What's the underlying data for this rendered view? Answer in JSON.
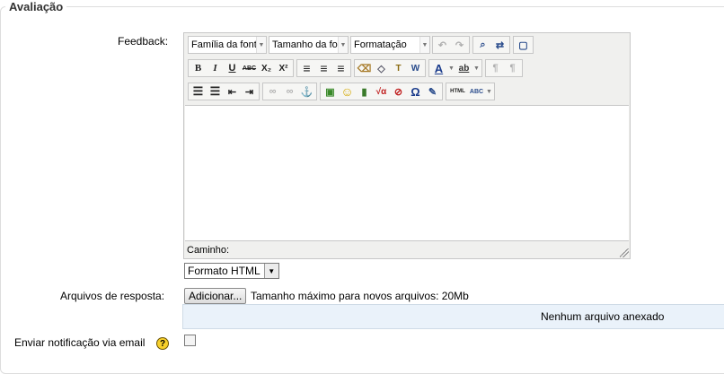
{
  "section": {
    "title": "Avaliação"
  },
  "feedback": {
    "label": "Feedback:",
    "font_family": "Família da font",
    "font_size": "Tamanho da fo",
    "format_block": "Formatação",
    "path_label": "Caminho:",
    "text_format": "Formato HTML",
    "icons": {
      "undo": "↶",
      "redo": "↷",
      "find": "⌕",
      "replace": "⇄",
      "fullscreen": "▢",
      "bold": "B",
      "italic": "I",
      "underline": "U",
      "strike": "ABC",
      "sub": "X₂",
      "sup": "X²",
      "align_left": "≡",
      "align_center": "≡",
      "align_right": "≡",
      "cleanup": "⌫",
      "erase": "◇",
      "paste_text": "T",
      "paste_word": "W",
      "forecolor": "A",
      "backcolor": "ab",
      "ltr": "¶",
      "rtl": "¶",
      "ul": "☰",
      "ol": "☰",
      "outdent": "⇤",
      "indent": "⇥",
      "link": "∞",
      "unlink": "∞",
      "anchor": "⚓",
      "image": "▣",
      "emoticon": "☺",
      "media": "▮",
      "equation": "√α",
      "nolink": "⊘",
      "charmap": "Ω",
      "edit": "✎",
      "html": "HTML",
      "spell": "ABC"
    }
  },
  "attachments": {
    "label": "Arquivos de resposta:",
    "add_button": "Adicionar...",
    "max_size": "Tamanho máximo para novos arquivos: 20Mb",
    "empty": "Nenhum arquivo anexado"
  },
  "notify": {
    "label": "Enviar notificação via email",
    "help_icon": "?"
  }
}
